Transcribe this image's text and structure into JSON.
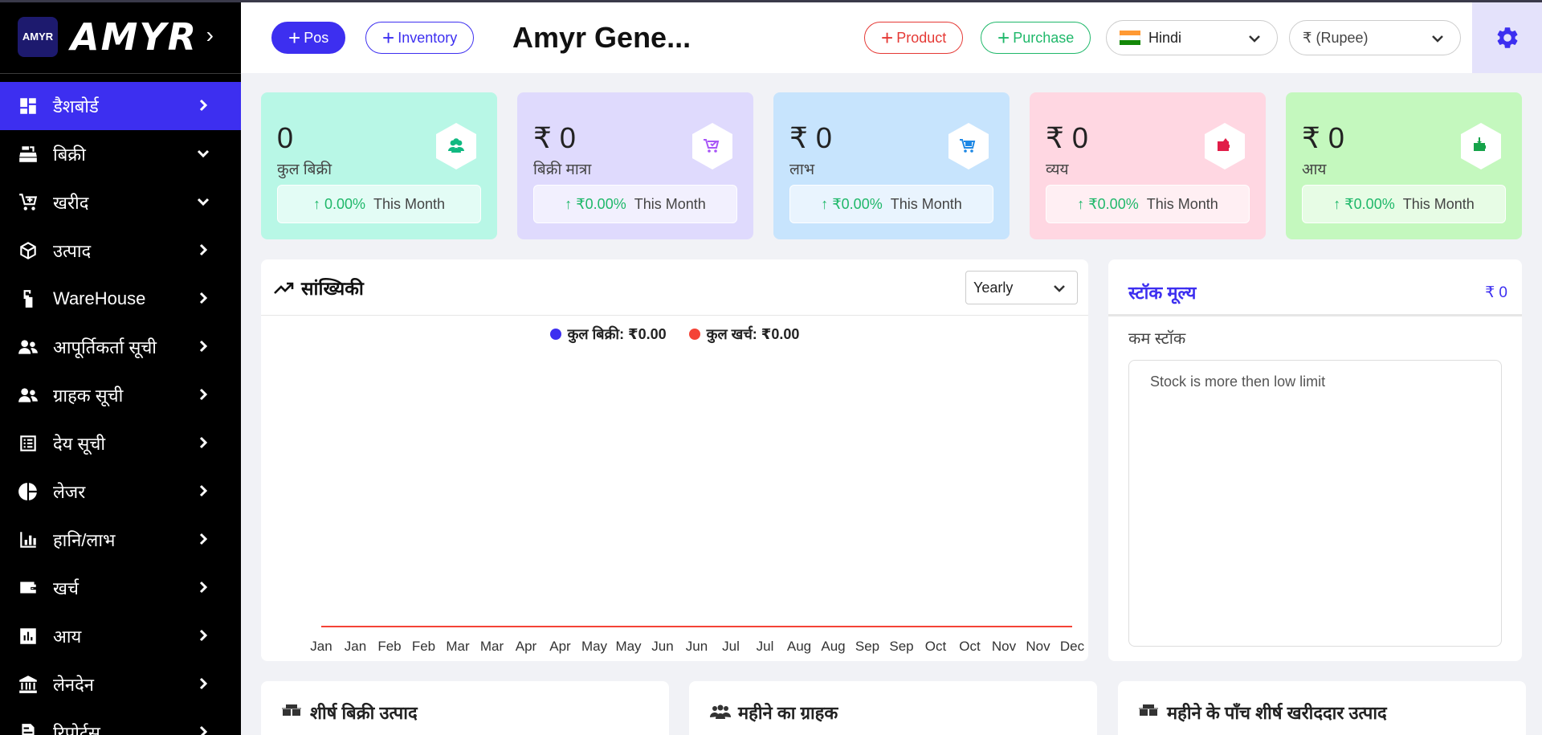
{
  "brand": {
    "logo_text": "AMYR",
    "name": "AMYR"
  },
  "sidebar": {
    "items": [
      {
        "label": "डैशबोर्ड",
        "icon": "dashboard-icon",
        "chevron": "right",
        "active": true
      },
      {
        "label": "बिक्री",
        "icon": "cash-register-icon",
        "chevron": "down"
      },
      {
        "label": "खरीद",
        "icon": "cart-plus-icon",
        "chevron": "down"
      },
      {
        "label": "उत्पाद",
        "icon": "box-icon",
        "chevron": "right"
      },
      {
        "label": "WareHouse",
        "icon": "warehouse-icon",
        "chevron": "right"
      },
      {
        "label": "आपूर्तिकर्ता सूची",
        "icon": "users-icon",
        "chevron": "right"
      },
      {
        "label": "ग्राहक सूची",
        "icon": "users-icon",
        "chevron": "right"
      },
      {
        "label": "देय सूची",
        "icon": "list-icon",
        "chevron": "right"
      },
      {
        "label": "लेजर",
        "icon": "pie-chart-icon",
        "chevron": "right"
      },
      {
        "label": "हानि/लाभ",
        "icon": "bar-chart-icon",
        "chevron": "right"
      },
      {
        "label": "खर्च",
        "icon": "wallet-icon",
        "chevron": "right"
      },
      {
        "label": "आय",
        "icon": "poll-icon",
        "chevron": "right"
      },
      {
        "label": "लेनदेन",
        "icon": "bank-icon",
        "chevron": "right"
      },
      {
        "label": "रिपोर्ट्स",
        "icon": "report-icon",
        "chevron": "right"
      }
    ]
  },
  "header": {
    "pos_label": "Pos",
    "inventory_label": "Inventory",
    "company": "Amyr Gene...",
    "product_label": "Product",
    "purchase_label": "Purchase",
    "language": "Hindi",
    "currency": "₹ (Rupee)"
  },
  "cards": [
    {
      "value": "0",
      "label": "कुल बिक्री",
      "pct": "↑ 0.00%",
      "period": "This Month",
      "bg": "#b8f7e6",
      "icon": "users-icon",
      "icon_color": "#10b981"
    },
    {
      "value": "₹ 0",
      "label": "बिक्री मात्रा",
      "pct": "↑ ₹0.00%",
      "period": "This Month",
      "bg": "#dfdafd",
      "icon": "cart-check-icon",
      "icon_color": "#a855f7"
    },
    {
      "value": "₹ 0",
      "label": "लाभ",
      "pct": "↑ ₹0.00%",
      "period": "This Month",
      "bg": "#c7e4fd",
      "icon": "cart-icon",
      "icon_color": "#1e88e5"
    },
    {
      "value": "₹ 0",
      "label": "व्यय",
      "pct": "↑ ₹0.00%",
      "period": "This Month",
      "bg": "#ffd7e2",
      "icon": "wallet-icon",
      "icon_color": "#e11d48"
    },
    {
      "value": "₹ 0",
      "label": "आय",
      "pct": "↑ ₹0.00%",
      "period": "This Month",
      "bg": "#c4f8be",
      "icon": "wallet-download-icon",
      "icon_color": "#16a34a"
    }
  ],
  "stats": {
    "title": "सांख्यिकी",
    "period": "Yearly",
    "legend": [
      {
        "label": "कुल बिक्री: ₹0.00",
        "color": "#3d2ff0"
      },
      {
        "label": "कुल खर्च: ₹0.00",
        "color": "#f44336"
      }
    ]
  },
  "chart_data": {
    "type": "line",
    "categories": [
      "Jan",
      "Jan",
      "Feb",
      "Feb",
      "Mar",
      "Mar",
      "Apr",
      "Apr",
      "May",
      "May",
      "Jun",
      "Jun",
      "Jul",
      "Jul",
      "Aug",
      "Aug",
      "Sep",
      "Sep",
      "Oct",
      "Oct",
      "Nov",
      "Nov",
      "Dec"
    ],
    "series": [
      {
        "name": "कुल बिक्री: ₹0.00",
        "values": [
          0,
          0,
          0,
          0,
          0,
          0,
          0,
          0,
          0,
          0,
          0,
          0,
          0,
          0,
          0,
          0,
          0,
          0,
          0,
          0,
          0,
          0,
          0
        ],
        "color": "#3d2ff0"
      },
      {
        "name": "कुल खर्च: ₹0.00",
        "values": [
          0,
          0,
          0,
          0,
          0,
          0,
          0,
          0,
          0,
          0,
          0,
          0,
          0,
          0,
          0,
          0,
          0,
          0,
          0,
          0,
          0,
          0,
          0
        ],
        "color": "#f44336"
      }
    ],
    "grid": false,
    "legend_position": "top-center"
  },
  "stock": {
    "title": "स्टॉक मूल्य",
    "value": "₹ 0",
    "low_label": "कम स्टॉक",
    "low_text": "Stock is more then low limit"
  },
  "bottom": [
    {
      "title": "शीर्ष बिक्री उत्पाद",
      "icon": "boxes-icon"
    },
    {
      "title": "महीने का ग्राहक",
      "icon": "users-icon"
    },
    {
      "title": "महीने के पाँच शीर्ष खरीददार उत्पाद",
      "icon": "boxes-icon"
    }
  ]
}
